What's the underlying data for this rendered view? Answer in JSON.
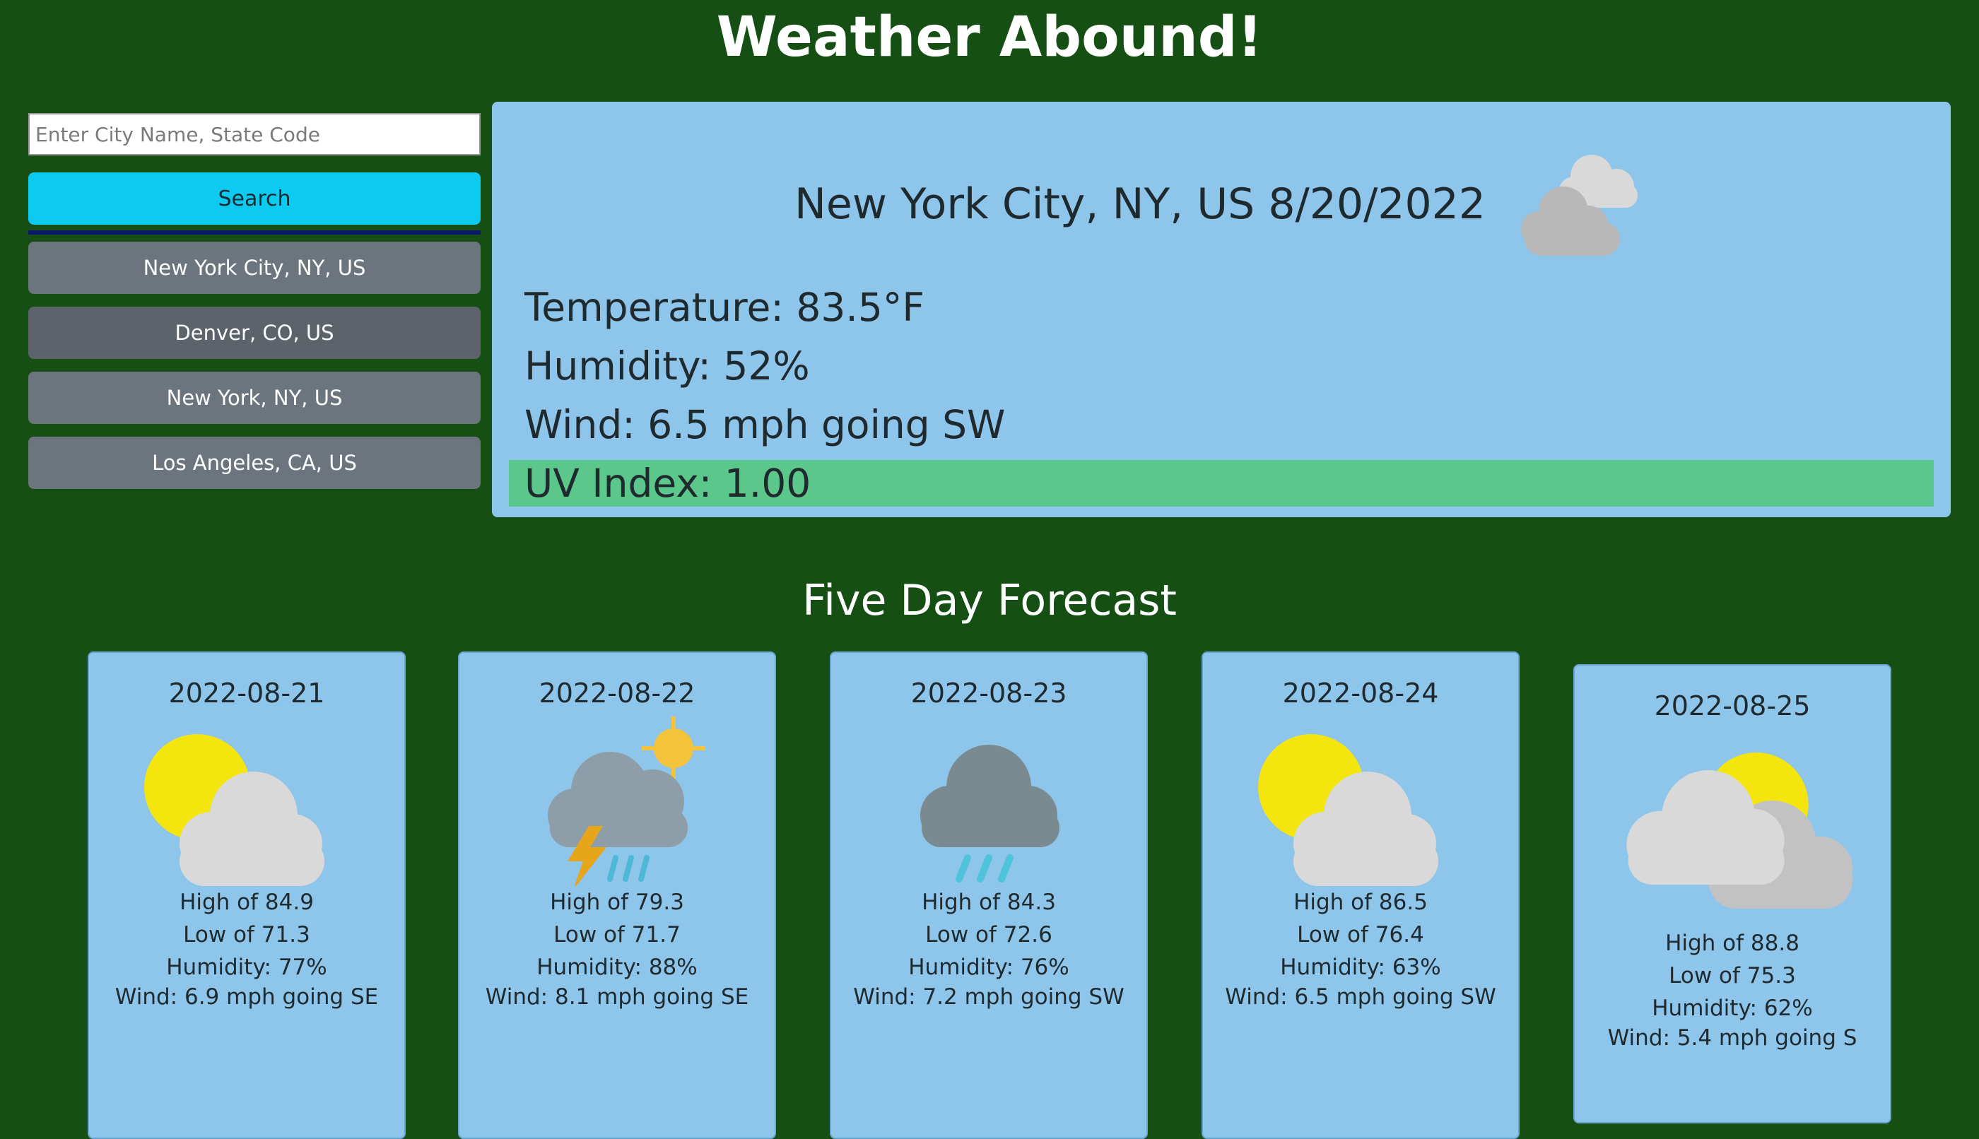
{
  "header": {
    "title": "Weather Abound!"
  },
  "search": {
    "placeholder": "Enter City Name, State Code",
    "value": "",
    "button_label": "Search"
  },
  "history": [
    {
      "label": "New York City, NY, US"
    },
    {
      "label": "Denver, CO, US"
    },
    {
      "label": "New York, NY, US"
    },
    {
      "label": "Los Angeles, CA, US"
    }
  ],
  "current": {
    "title": "New York City, NY, US 8/20/2022",
    "icon": "cloudy-icon",
    "temperature": "Temperature: 83.5°F",
    "humidity": "Humidity: 52%",
    "wind": "Wind: 6.5 mph going SW",
    "uv": "UV Index: 1.00",
    "uv_color": "#5bc78a"
  },
  "forecast": {
    "title": "Five Day Forecast",
    "days": [
      {
        "date": "2022-08-21",
        "icon": "partly-cloudy-icon",
        "high": "High of 84.9",
        "low": "Low of 71.3",
        "humidity": "Humidity: 77%",
        "wind": "Wind: 6.9 mph going SE"
      },
      {
        "date": "2022-08-22",
        "icon": "thunderstorm-sun-icon",
        "high": "High of 79.3",
        "low": "Low of 71.7",
        "humidity": "Humidity: 88%",
        "wind": "Wind: 8.1 mph going SE"
      },
      {
        "date": "2022-08-23",
        "icon": "rain-icon",
        "high": "High of 84.3",
        "low": "Low of 72.6",
        "humidity": "Humidity: 76%",
        "wind": "Wind: 7.2 mph going SW"
      },
      {
        "date": "2022-08-24",
        "icon": "partly-cloudy-icon",
        "high": "High of 86.5",
        "low": "Low of 76.4",
        "humidity": "Humidity: 63%",
        "wind": "Wind: 6.5 mph going SW"
      },
      {
        "date": "2022-08-25",
        "icon": "clouds-sun-icon",
        "high": "High of 88.8",
        "low": "Low of 75.3",
        "humidity": "Humidity: 62%",
        "wind": "Wind: 5.4 mph going S"
      }
    ]
  },
  "colors": {
    "background": "#154f14",
    "panel": "#8ec5ea",
    "search_button": "#0dcaf0",
    "history_button": "#6c757d",
    "uv_low": "#5bc78a"
  }
}
